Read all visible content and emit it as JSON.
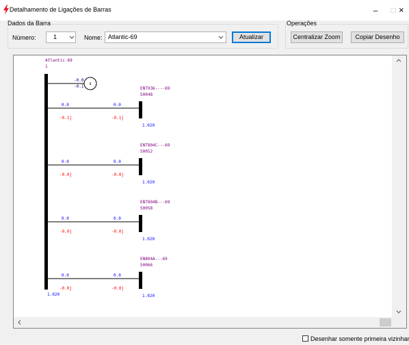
{
  "window": {
    "title": "Detalhamento de Ligações de Barras",
    "icon": "lightning-icon",
    "minimize_glyph": "–",
    "maximize_glyph": "□",
    "close_glyph": "×"
  },
  "dados_barra": {
    "group_label": "Dados da Barra",
    "numero_label": "Número:",
    "numero_value": "1",
    "nome_label": "Nome:",
    "nome_value": "Atlantic-69",
    "atualizar_label": "Atualizar"
  },
  "operacoes": {
    "group_label": "Operações",
    "centralizar_label": "Centralizar Zoom",
    "copiar_label": "Copiar Desenho"
  },
  "diagram": {
    "main_bus": {
      "name": "Atlantic-69",
      "number": "1",
      "voltage": "1.020"
    },
    "shunt": {
      "p": "-0.0",
      "q": "-0.1",
      "symbol": "s"
    },
    "branches": [
      {
        "bus_name": "ENT936----69",
        "bus_number": "50048",
        "p_from": "0.0",
        "p_to": "0.0",
        "q_from": "-0.1j",
        "q_to": "-0.1j",
        "voltage": "1.020"
      },
      {
        "bus_name": "ENT804C---69",
        "bus_number": "50052",
        "p_from": "0.0",
        "p_to": "0.0",
        "q_from": "-0.0j",
        "q_to": "-0.0j",
        "voltage": "1.020"
      },
      {
        "bus_name": "ENT804B---69",
        "bus_number": "50058",
        "p_from": "0.0",
        "p_to": "0.0",
        "q_from": "-0.0j",
        "q_to": "-0.0j",
        "voltage": "1.020"
      },
      {
        "bus_name": "EN804A---69",
        "bus_number": "50066",
        "p_from": "0.0",
        "p_to": "0.0",
        "q_from": "-0.0j",
        "q_to": "-0.0j",
        "voltage": "1.020"
      }
    ]
  },
  "footer": {
    "checkbox_label": "Desenhar somente primeira vizinhança",
    "checkbox_checked": false
  },
  "colors": {
    "bus_name": "#800080",
    "p_value": "#0000ff",
    "q_value": "#ff0000",
    "primary_button_border": "#0078d7",
    "app_icon": "#e81123"
  }
}
